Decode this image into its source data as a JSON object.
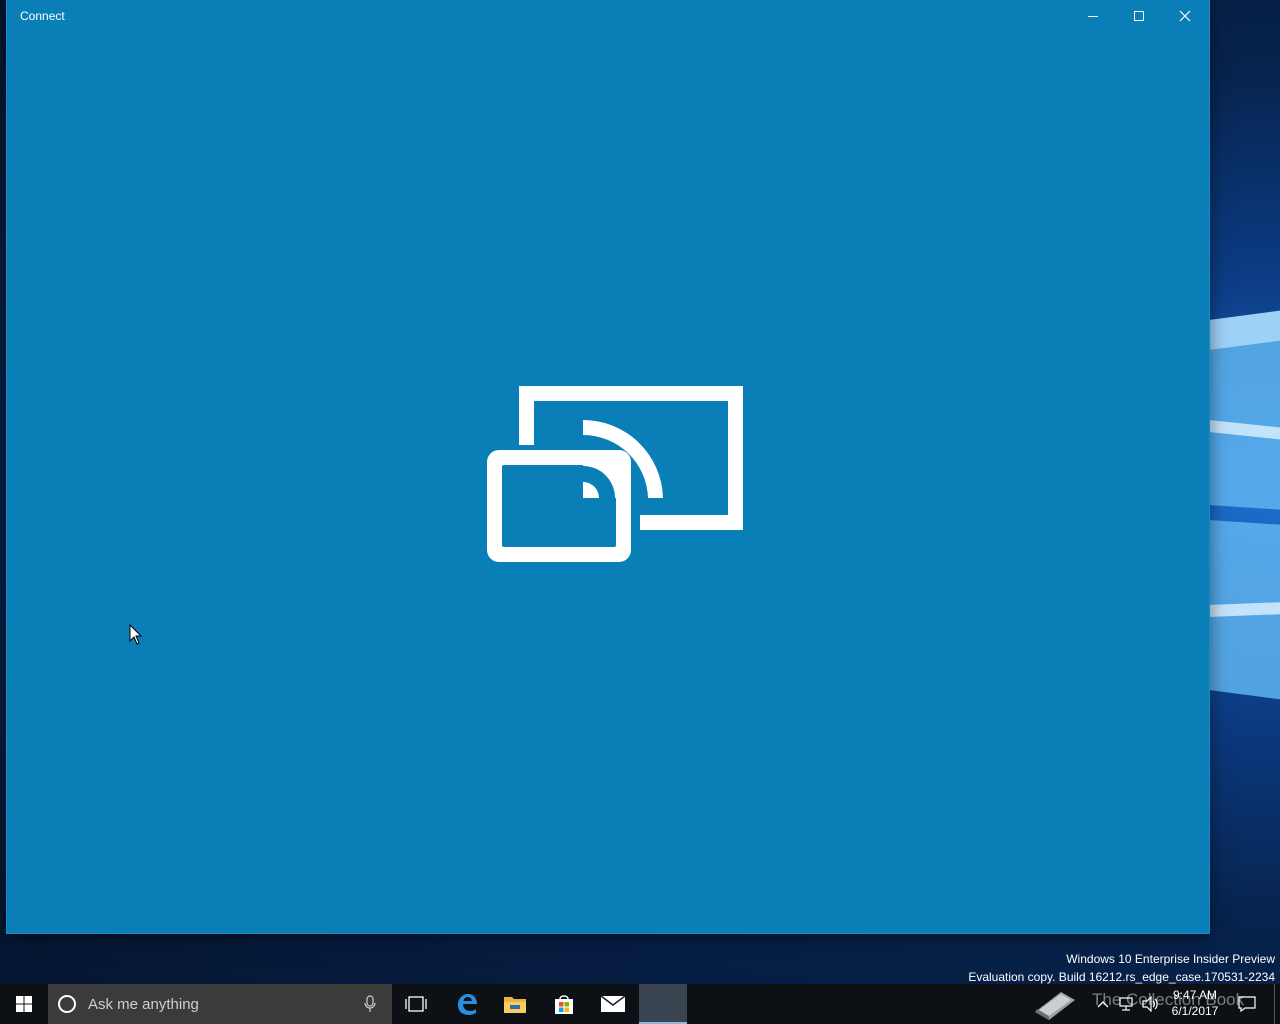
{
  "window": {
    "title": "Connect"
  },
  "watermark": {
    "line1": "Windows 10 Enterprise Insider Preview",
    "line2": "Evaluation copy. Build 16212.rs_edge_case.170531-2234"
  },
  "taskbar": {
    "search_placeholder": "Ask me anything",
    "clock_time": "9:47 AM",
    "clock_date": "6/1/2017",
    "overlay_text": "The Collection Book"
  },
  "colors": {
    "app_background": "#0a7eb6",
    "taskbar": "#0d1116",
    "search_box": "#3b3b3b"
  },
  "icons": {
    "start": "windows-logo",
    "search": "cortana-ring",
    "mic": "microphone",
    "task_view": "task-view",
    "edge": "edge",
    "explorer": "folder",
    "store": "store-bag",
    "mail": "envelope",
    "app_main": "cast-to-device"
  }
}
